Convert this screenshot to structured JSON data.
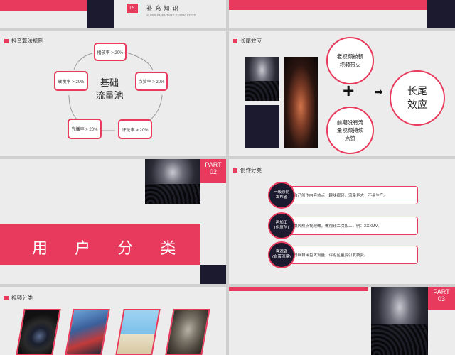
{
  "slide1": {
    "num": "05",
    "title": "补 充 知 识",
    "subtitle": "SUPPLEMENTARY KNOWLEDGE"
  },
  "slide3": {
    "heading": "抖音算法机制",
    "center": "基础\n流量池",
    "nodes": {
      "top": "播放率 > 20%",
      "left": "转发率 > 20%",
      "right": "点赞率 > 20%",
      "bottom_left": "完播率 > 20%",
      "bottom_right": "评论率 > 20%"
    }
  },
  "slide4": {
    "heading": "长尾效应",
    "top_circle": "老视频被新\n视频带火",
    "bottom_circle": "前期没有流\n量视频持续\n点赞",
    "result": "长尾\n效应",
    "plus": "+",
    "arrow": "➡"
  },
  "slide5": {
    "part_label": "PART",
    "part_num": "02",
    "banner": "用 户 分 类"
  },
  "slide6": {
    "heading": "创作分类",
    "rows": [
      {
        "bubble": "一级原创\n发布者",
        "text": "自己创作内容热点，趣味视频，流量巨大，不易生产。"
      },
      {
        "bubble": "再加工\n(伪原创)",
        "text": "跟风热点视频做，做视频二次加工，例：XXXMV。"
      },
      {
        "bubble": "旁观者\n(自带流量)",
        "text": "粉丝自带巨大流量，评论区量变引发质变。"
      }
    ]
  },
  "slide7": {
    "heading": "视频分类"
  },
  "slide8": {
    "part_label": "PART",
    "part_num": "03"
  },
  "colors": {
    "accent": "#e83a5c",
    "dark": "#1c1a2e",
    "slide_bg": "#ececec"
  }
}
